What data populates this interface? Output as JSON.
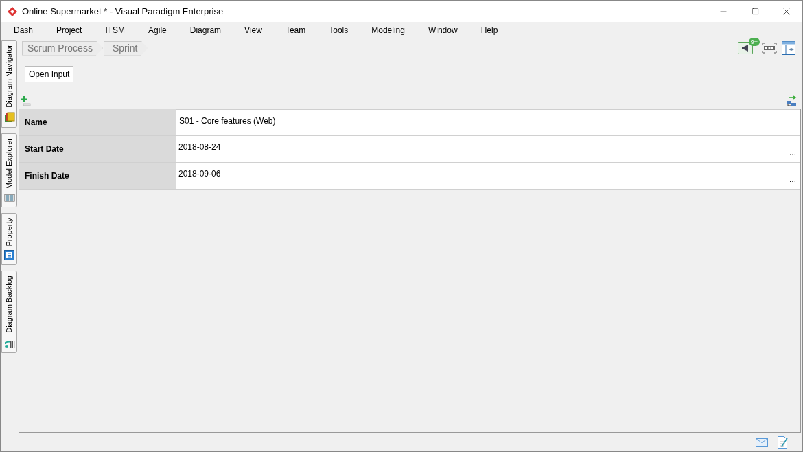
{
  "window": {
    "title": "Online Supermarket * - Visual Paradigm Enterprise"
  },
  "menu": [
    "Dash",
    "Project",
    "ITSM",
    "Agile",
    "Diagram",
    "View",
    "Team",
    "Tools",
    "Modeling",
    "Window",
    "Help"
  ],
  "side_tabs": [
    {
      "label": "Diagram Navigator",
      "kind": "navigator"
    },
    {
      "label": "Model Explorer",
      "kind": "explorer"
    },
    {
      "label": "Property",
      "kind": "property"
    },
    {
      "label": "Diagram Backlog",
      "kind": "backlog"
    }
  ],
  "breadcrumb": [
    "Scrum Process",
    "Sprint"
  ],
  "toolbar": {
    "notification_badge": "9+"
  },
  "open_input_button": "Open Input",
  "properties": [
    {
      "label": "Name",
      "value": "S01 - Core features (Web)",
      "editing": true
    },
    {
      "label": "Start Date",
      "value": "2018-08-24",
      "editing": false,
      "button": "..."
    },
    {
      "label": "Finish Date",
      "value": "2018-09-06",
      "editing": false,
      "button": "..."
    }
  ]
}
